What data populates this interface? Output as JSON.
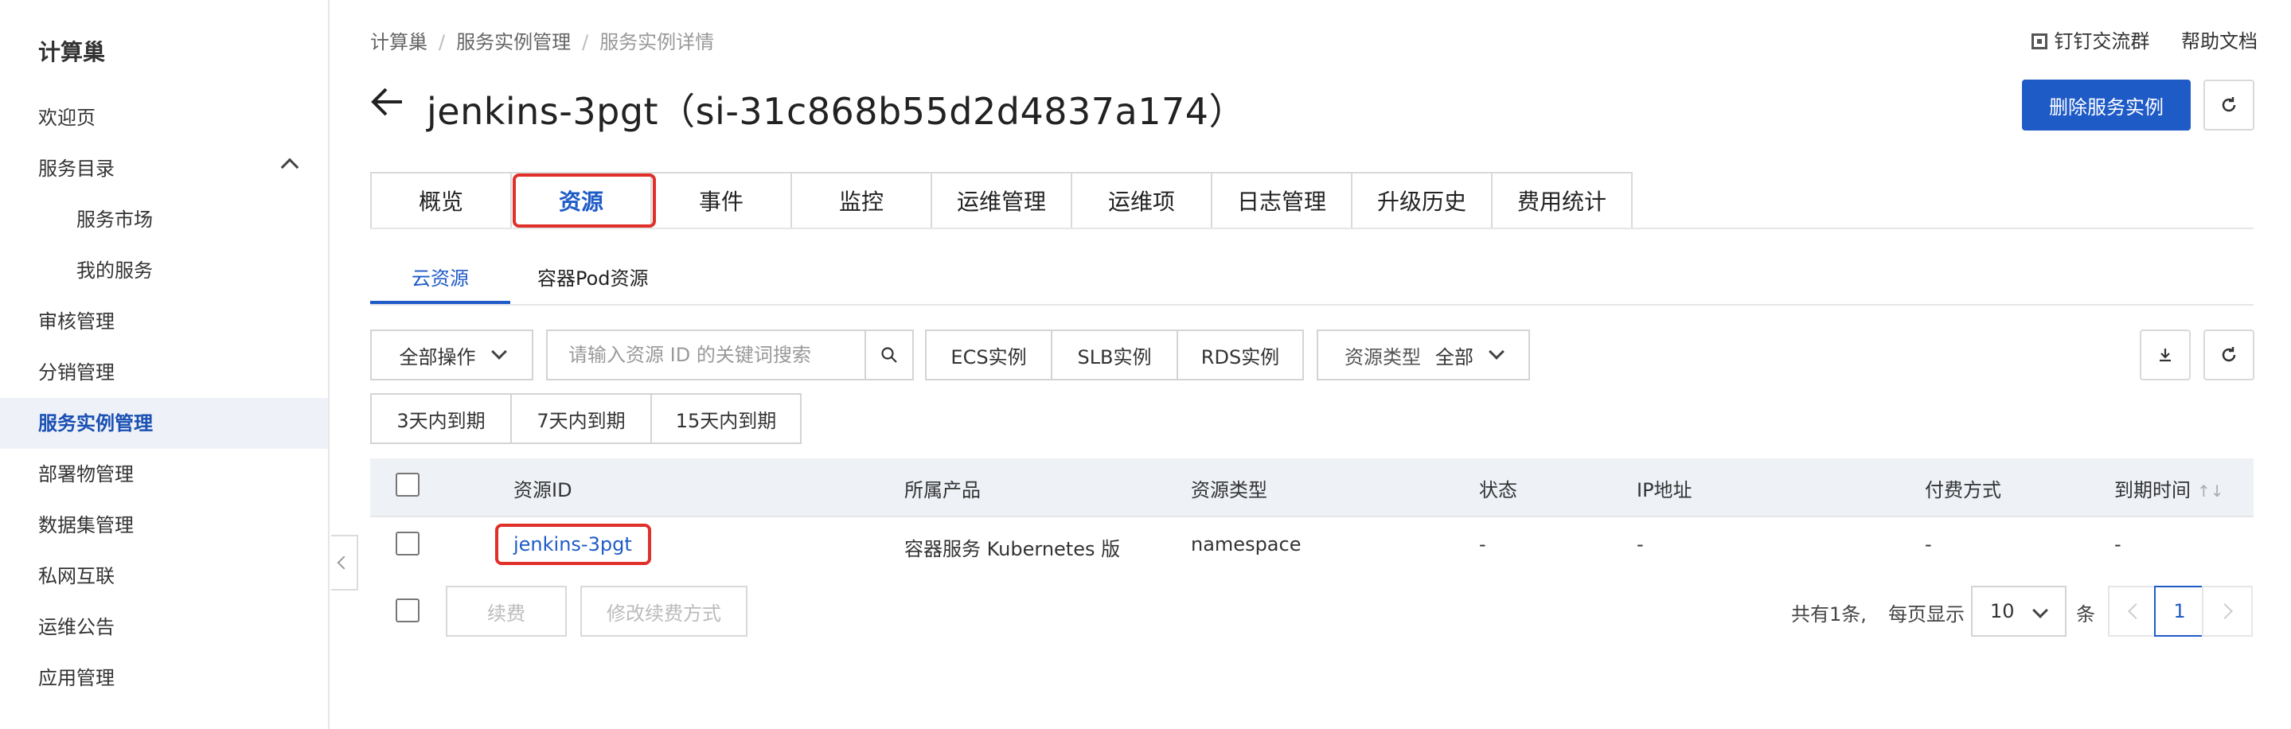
{
  "sidebar": {
    "title": "计算巢",
    "items": [
      {
        "label": "欢迎页"
      },
      {
        "label": "服务目录"
      },
      {
        "label": "服务市场"
      },
      {
        "label": "我的服务"
      },
      {
        "label": "审核管理"
      },
      {
        "label": "分销管理"
      },
      {
        "label": "服务实例管理"
      },
      {
        "label": "部署物管理"
      },
      {
        "label": "数据集管理"
      },
      {
        "label": "私网互联"
      },
      {
        "label": "运维公告"
      },
      {
        "label": "应用管理"
      }
    ],
    "active": "服务实例管理"
  },
  "breadcrumb": [
    "计算巢",
    "服务实例管理",
    "服务实例详情"
  ],
  "top_links": {
    "group": "钉钉交流群",
    "help": "帮助文档"
  },
  "header": {
    "title": "jenkins-3pgt（si-31c868b55d2d4837a174）",
    "delete_button": "删除服务实例"
  },
  "main_tabs": [
    "概览",
    "资源",
    "事件",
    "监控",
    "运维管理",
    "运维项",
    "日志管理",
    "升级历史",
    "费用统计"
  ],
  "active_main_tab": "资源",
  "sub_tabs": [
    "云资源",
    "容器Pod资源"
  ],
  "active_sub_tab": "云资源",
  "toolbar": {
    "bulk_action": "全部操作",
    "search_placeholder": "请输入资源 ID 的关键词搜索",
    "filters": [
      "ECS实例",
      "SLB实例",
      "RDS实例"
    ],
    "resource_type_label": "资源类型",
    "resource_type_value": "全部",
    "expiry_filters": [
      "3天内到期",
      "7天内到期",
      "15天内到期"
    ]
  },
  "table": {
    "columns": [
      "资源ID",
      "所属产品",
      "资源类型",
      "状态",
      "IP地址",
      "付费方式",
      "到期时间"
    ],
    "rows": [
      {
        "id": "jenkins-3pgt",
        "product": "容器服务 Kubernetes 版",
        "type": "namespace",
        "status": "-",
        "ip": "-",
        "billing": "-",
        "expiry": "-"
      }
    ]
  },
  "footer": {
    "renew": "续费",
    "change_renew": "修改续费方式",
    "total": "共有1条,",
    "per_page_label": "每页显示",
    "per_page_value": "10",
    "unit": "条",
    "current_page": "1"
  },
  "colors": {
    "primary": "#1f5bc7",
    "highlight": "#e0302a"
  }
}
